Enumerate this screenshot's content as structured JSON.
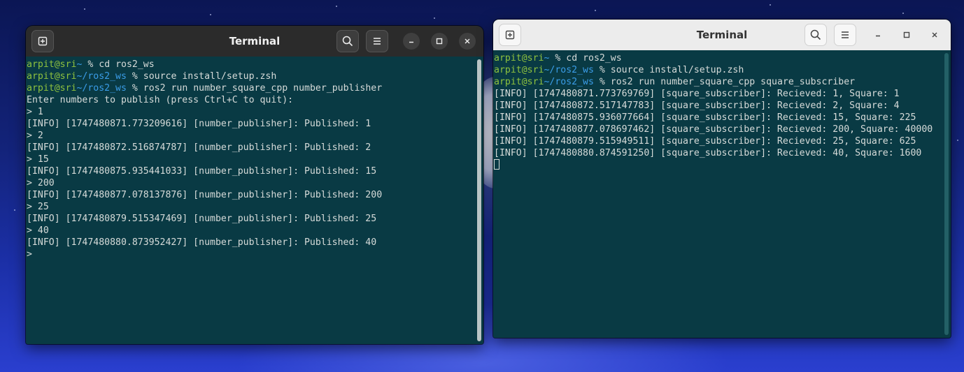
{
  "desktop": {
    "wallpaper": "blue-abstract-wallpaper"
  },
  "left_terminal": {
    "title": "Terminal",
    "lines": [
      {
        "user": "arpit@sri",
        "path": "~",
        "prompt": " % ",
        "cmd": "cd ros2_ws"
      },
      {
        "user": "arpit@sri",
        "path": "~/ros2_ws",
        "prompt": " % ",
        "cmd": "source install/setup.zsh"
      },
      {
        "user": "arpit@sri",
        "path": "~/ros2_ws",
        "prompt": " % ",
        "cmd": "ros2 run number_square_cpp number_publisher"
      },
      {
        "text": "Enter numbers to publish (press Ctrl+C to quit):"
      },
      {
        "text": "> 1"
      },
      {
        "text": "[INFO] [1747480871.773209616] [number_publisher]: Published: 1"
      },
      {
        "text": "> 2"
      },
      {
        "text": "[INFO] [1747480872.516874787] [number_publisher]: Published: 2"
      },
      {
        "text": "> 15"
      },
      {
        "text": "[INFO] [1747480875.935441033] [number_publisher]: Published: 15"
      },
      {
        "text": "> 200"
      },
      {
        "text": "[INFO] [1747480877.078137876] [number_publisher]: Published: 200"
      },
      {
        "text": "> 25"
      },
      {
        "text": "[INFO] [1747480879.515347469] [number_publisher]: Published: 25"
      },
      {
        "text": "> 40"
      },
      {
        "text": "[INFO] [1747480880.873952427] [number_publisher]: Published: 40"
      },
      {
        "text": ">"
      }
    ]
  },
  "right_terminal": {
    "title": "Terminal",
    "lines": [
      {
        "user": "arpit@sri",
        "path": "~",
        "prompt": " % ",
        "cmd": "cd ros2_ws"
      },
      {
        "user": "arpit@sri",
        "path": "~/ros2_ws",
        "prompt": " % ",
        "cmd": "source install/setup.zsh"
      },
      {
        "user": "arpit@sri",
        "path": "~/ros2_ws",
        "prompt": " % ",
        "cmd": "ros2 run number_square_cpp square_subscriber"
      },
      {
        "text": "[INFO] [1747480871.773769769] [square_subscriber]: Recieved: 1, Square: 1"
      },
      {
        "text": "[INFO] [1747480872.517147783] [square_subscriber]: Recieved: 2, Square: 4"
      },
      {
        "text": "[INFO] [1747480875.936077664] [square_subscriber]: Recieved: 15, Square: 225"
      },
      {
        "text": "[INFO] [1747480877.078697462] [square_subscriber]: Recieved: 200, Square: 40000"
      },
      {
        "text": "[INFO] [1747480879.515949511] [square_subscriber]: Recieved: 25, Square: 625"
      },
      {
        "text": "[INFO] [1747480880.874591250] [square_subscriber]: Recieved: 40, Square: 1600"
      },
      {
        "cursor": true
      }
    ]
  },
  "icons": [
    "new-tab-icon",
    "search-icon",
    "hamburger-menu-icon",
    "minimize-icon",
    "maximize-icon",
    "close-icon"
  ],
  "colors": {
    "terminal_bg": "#093a44",
    "terminal_fg": "#d6dbd9",
    "prompt_user": "#8fc23e",
    "prompt_path": "#3b9de8",
    "titlebar_dark": "#2b2b2b",
    "titlebar_light": "#ececec"
  }
}
